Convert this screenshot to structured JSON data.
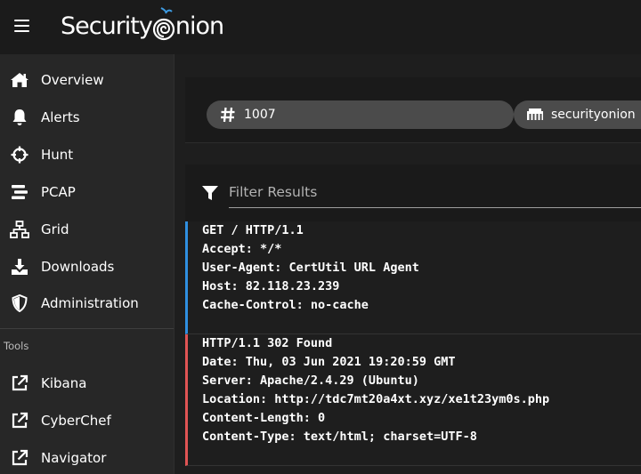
{
  "app": {
    "brand_prefix": "Security",
    "brand_suffix": "nion"
  },
  "sidebar": {
    "items": [
      {
        "label": "Overview",
        "icon": "home-icon"
      },
      {
        "label": "Alerts",
        "icon": "bell-icon"
      },
      {
        "label": "Hunt",
        "icon": "crosshairs-icon"
      },
      {
        "label": "PCAP",
        "icon": "stream-icon"
      },
      {
        "label": "Grid",
        "icon": "sitemap-icon"
      },
      {
        "label": "Downloads",
        "icon": "download-icon"
      },
      {
        "label": "Administration",
        "icon": "shield-icon"
      }
    ],
    "tools_label": "Tools",
    "tools": [
      {
        "label": "Kibana",
        "icon": "external-link-icon"
      },
      {
        "label": "CyberChef",
        "icon": "external-link-icon"
      },
      {
        "label": "Navigator",
        "icon": "external-link-icon"
      }
    ]
  },
  "main": {
    "chip_id": "1007",
    "chip_host": "securityonion",
    "filter_placeholder": "Filter Results",
    "request_lines": [
      "GET / HTTP/1.1",
      "Accept: */*",
      "User-Agent: CertUtil URL Agent",
      "Host: 82.118.23.239",
      "Cache-Control: no-cache"
    ],
    "response_lines": [
      "HTTP/1.1 302 Found",
      "Date: Thu, 03 Jun 2021 19:20:59 GMT",
      "Server: Apache/2.4.29 (Ubuntu)",
      "Location: http://tdc7mt20a4xt.xyz/xe1t23ym0s.php",
      "Content-Length: 0",
      "Content-Type: text/html; charset=UTF-8"
    ]
  },
  "colors": {
    "request_accent": "#2f8fe0",
    "response_accent": "#e05454",
    "logo_accent": "#3d9ae0"
  }
}
